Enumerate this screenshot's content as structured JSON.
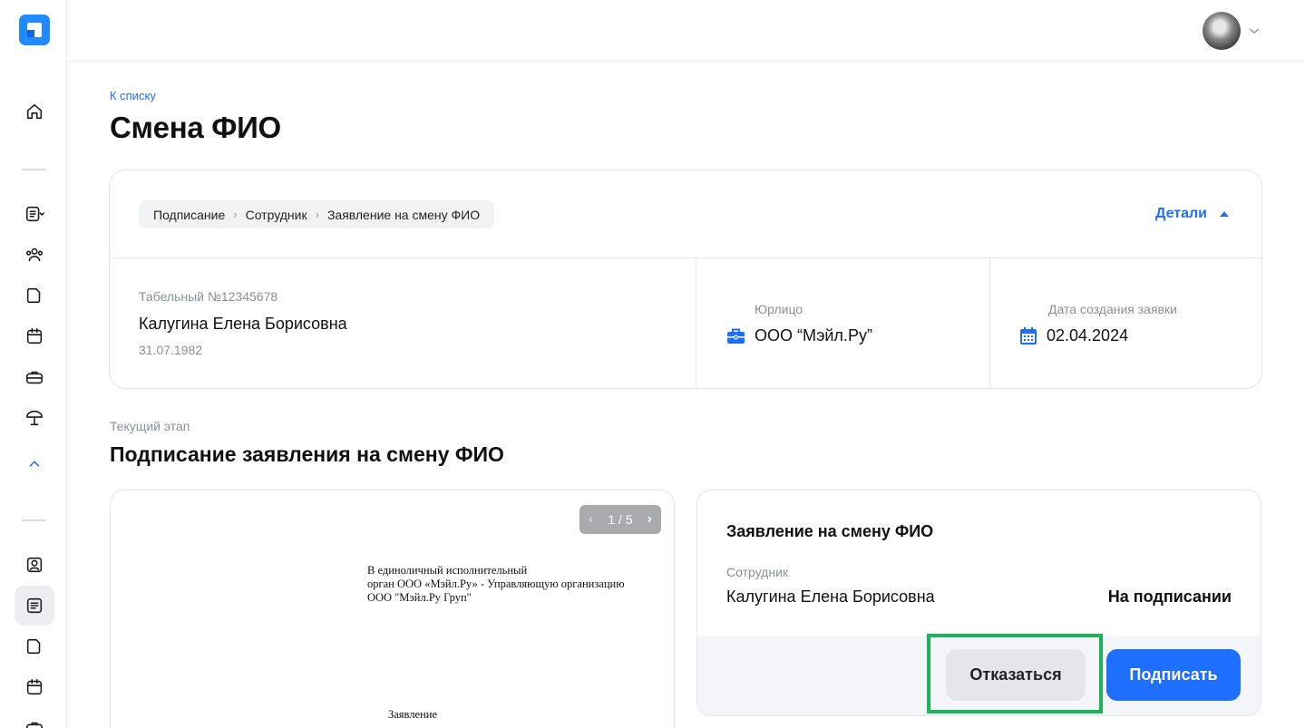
{
  "sidebar": {
    "logo": "app-logo",
    "icons": [
      "home-icon",
      "document-list-icon",
      "people-icon",
      "file-icon",
      "calendar-icon",
      "briefcase-icon",
      "umbrella-icon",
      "chevron-up-icon",
      "profile-icon",
      "document-list-icon",
      "file-icon",
      "calendar-icon",
      "briefcase-icon"
    ]
  },
  "header": {
    "avatar": "user-avatar"
  },
  "page": {
    "back_link": "К списку",
    "title": "Смена ФИО"
  },
  "request": {
    "breadcrumbs": [
      "Подписание",
      "Сотрудник",
      "Заявление на смену ФИО"
    ],
    "details_label": "Детали",
    "employee": {
      "tab_number": "Табельный №12345678",
      "name": "Калугина Елена Борисовна",
      "birth_date": "31.07.1982"
    },
    "legal_entity": {
      "label": "Юрлицо",
      "value": "ООО “Мэйл.Ру”"
    },
    "created": {
      "label": "Дата создания заявки",
      "value": "02.04.2024"
    }
  },
  "stage": {
    "label": "Текущий этап",
    "title": "Подписание заявления на смену ФИО"
  },
  "document": {
    "pager": "1 / 5",
    "lines": [
      "В единоличный исполнительный",
      "орган ООО «Мэйл.Ру» - Управляющую организацию",
      "ООО \"Мэйл.Ру Груп\""
    ],
    "heading": "Заявление"
  },
  "info": {
    "title": "Заявление на смену ФИО",
    "employee_label": "Сотрудник",
    "employee_name": "Калугина Елена Борисовна",
    "status": "На подписании",
    "refuse_label": "Отказаться",
    "sign_label": "Подписать"
  },
  "colors": {
    "accent": "#1f6fff",
    "highlight": "#1bb45a"
  }
}
